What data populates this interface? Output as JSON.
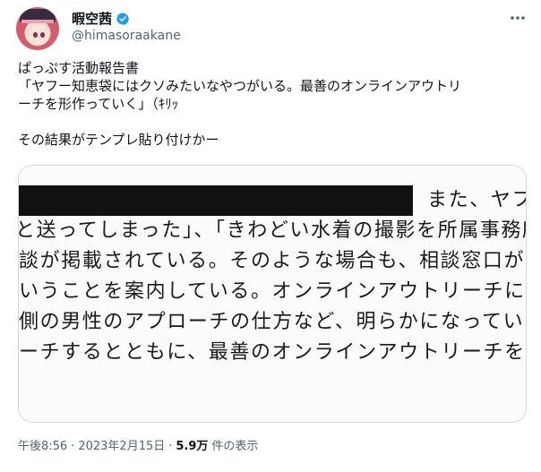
{
  "author": {
    "display_name": "暇空茜",
    "handle": "@himasoraakane",
    "verified": true,
    "verified_color": "#1d9bf0"
  },
  "tweet": {
    "lines": [
      "ぱっぷす活動報告書",
      "「ヤフー知恵袋にはクソみたいなやつがいる。最善のオンラインアウトリ",
      "ーチを形作っていく」（ｷﾘｯ",
      "",
      "その結果がテンプレ貼り付けかー"
    ]
  },
  "media": {
    "document_lines": [
      "また、ヤフ",
      "と送ってしまった」、「きわどい水着の撮影を所属事務所",
      "談が掲載されている。そのような場合も、相談窓口が",
      "いうことを案内している。オンラインアウトリーチに",
      "側の男性のアプローチの仕方など、明らかになってい",
      "ーチするとともに、最善のオンラインアウトリーチを"
    ]
  },
  "footer": {
    "time": "午後8:56",
    "separator": "·",
    "date": "2023年2月15日",
    "views_count": "5.9万",
    "views_label": "件の表示"
  },
  "icons": {
    "more": "more-dots-icon",
    "verified": "verified-badge-icon"
  }
}
